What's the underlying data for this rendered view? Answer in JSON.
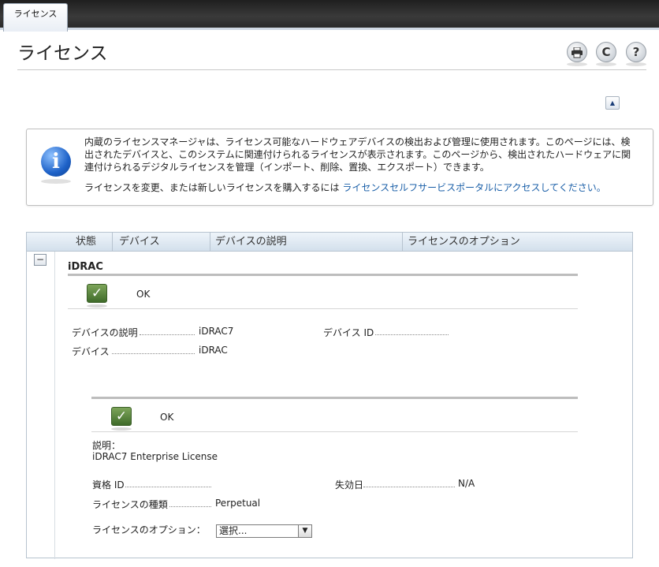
{
  "tabs": [
    {
      "label": "ライセンス"
    }
  ],
  "page": {
    "title": "ライセンス"
  },
  "toolbar": {
    "print_icon": "printer-icon",
    "refresh_icon": "refresh-icon",
    "help_icon": "help-icon",
    "refresh_glyph": "C",
    "help_glyph": "?"
  },
  "collapse_top_glyph": "▲",
  "info": {
    "icon": "info-icon",
    "glyph": "i",
    "text": "内蔵のライセンスマネージャは、ライセンス可能なハードウェアデバイスの検出および管理に使用されます。このページには、検出されたデバイスと、このシステムに関連付けられるライセンスが表示されます。このページから、検出されたハードウェアに関連付けられるデジタルライセンスを管理（インポート、削除、置換、エクスポート）できます。",
    "link_prefix": "ライセンスを変更、または新しいライセンスを購入するには ",
    "link_text": "ライセンスセルフサービスポータルにアクセスしてください。"
  },
  "grid": {
    "columns": [
      "状態",
      "デバイス",
      "デバイスの説明",
      "ライセンスのオプション"
    ],
    "expand_glyph": "−"
  },
  "device": {
    "name": "iDRAC",
    "status": "OK",
    "check_glyph": "✓",
    "description_label": "デバイスの説明",
    "description_value": "iDRAC7",
    "device_label": "デバイス",
    "device_value": "iDRAC",
    "device_id_label": "デバイス ID",
    "device_id_value": ""
  },
  "license": {
    "status": "OK",
    "desc_label": "説明：",
    "desc_value": "iDRAC7 Enterprise License",
    "entitlement_label": "資格 ID",
    "entitlement_value": "",
    "expiry_label": "失効日",
    "expiry_value": "N/A",
    "type_label": "ライセンスの種類",
    "type_value": "Perpetual",
    "options_label": "ライセンスのオプション：",
    "options_selected": "選択...",
    "dropdown_glyph": "▼"
  }
}
